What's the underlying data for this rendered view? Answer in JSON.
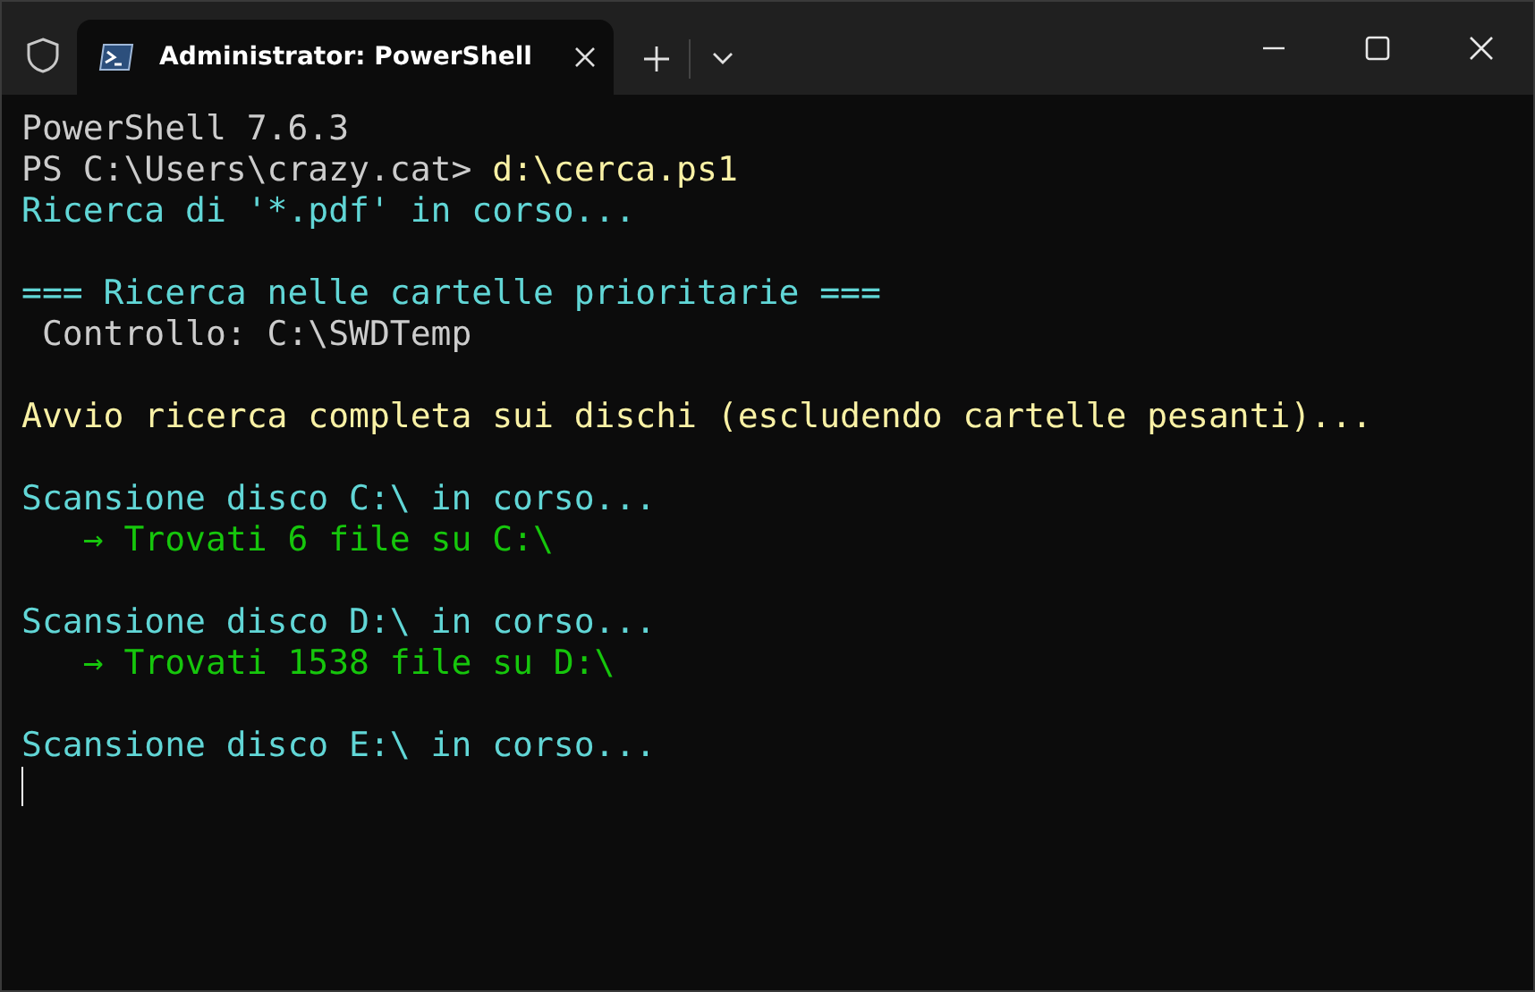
{
  "tabs": [
    {
      "title": "Administrator: PowerShell",
      "selected": true
    }
  ],
  "terminal": {
    "lines": [
      {
        "kind": "text",
        "segments": [
          {
            "text": "PowerShell 7.6.3",
            "kind": "plain"
          }
        ]
      },
      {
        "kind": "text",
        "segments": [
          {
            "text": "PS C:\\Users\\crazy.cat> ",
            "kind": "plain"
          },
          {
            "text": "d:\\cerca.ps1",
            "kind": "command"
          }
        ]
      },
      {
        "kind": "text",
        "segments": [
          {
            "text": "Ricerca di '*.pdf' in corso...",
            "kind": "info"
          }
        ]
      },
      {
        "kind": "blank"
      },
      {
        "kind": "text",
        "segments": [
          {
            "text": "=== Ricerca nelle cartelle prioritarie ===",
            "kind": "info"
          }
        ]
      },
      {
        "kind": "text",
        "segments": [
          {
            "text": " Controllo: C:\\SWDTemp",
            "kind": "plain"
          }
        ]
      },
      {
        "kind": "blank"
      },
      {
        "kind": "text",
        "segments": [
          {
            "text": "Avvio ricerca completa sui dischi (escludendo cartelle pesanti)...",
            "kind": "command"
          }
        ]
      },
      {
        "kind": "blank"
      },
      {
        "kind": "text",
        "segments": [
          {
            "text": "Scansione disco C:\\ in corso...",
            "kind": "info"
          }
        ]
      },
      {
        "kind": "text",
        "segments": [
          {
            "text": "   → Trovati 6 file su C:\\",
            "kind": "success"
          }
        ]
      },
      {
        "kind": "blank"
      },
      {
        "kind": "text",
        "segments": [
          {
            "text": "Scansione disco D:\\ in corso...",
            "kind": "info"
          }
        ]
      },
      {
        "kind": "text",
        "segments": [
          {
            "text": "   → Trovati 1538 file su D:\\",
            "kind": "success"
          }
        ]
      },
      {
        "kind": "blank"
      },
      {
        "kind": "text",
        "segments": [
          {
            "text": "Scansione disco E:\\ in corso...",
            "kind": "info"
          }
        ]
      },
      {
        "kind": "cursor"
      }
    ]
  }
}
